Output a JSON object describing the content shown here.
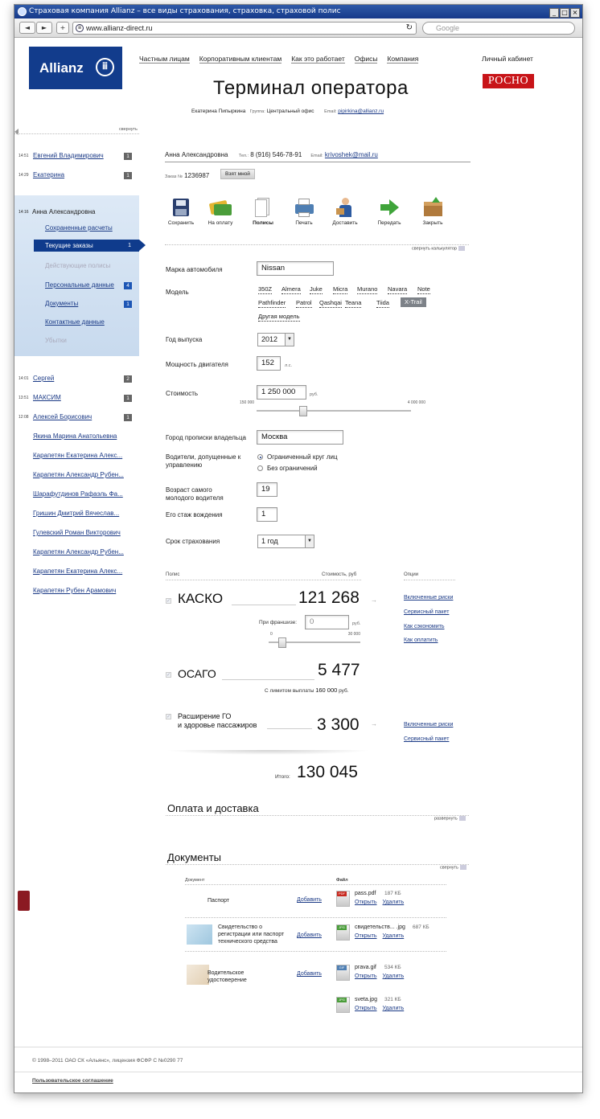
{
  "browser": {
    "title": "Страховая компания Allianz – все виды страхования, страховка, страховой полис",
    "url": "www.allianz-direct.ru",
    "search_placeholder": "Google",
    "back": "◄",
    "forward": "►",
    "add": "+"
  },
  "header": {
    "logo": "Allianz",
    "logo_symbol": "ⅲ",
    "nav": [
      "Частным лицам",
      "Корпоративным клиентам",
      "Как это работает",
      "Офисы",
      "Компания"
    ],
    "cabinet": "Личный кабинет",
    "partner_logo": "РОСНО",
    "page_title": "Терминал оператора",
    "operator_name": "Екатерина Пипыркина",
    "group_label": "Группа:",
    "group_value": "Центральный офис",
    "email_label": "Email:",
    "email_value": "pipirkina@allianz.ru"
  },
  "sidebar": {
    "collapse_label": "свернуть",
    "clients_top": [
      {
        "time": "14:51",
        "name": "Евгений Владимирович",
        "count": "1"
      },
      {
        "time": "14:29",
        "name": "Екатерина",
        "count": "1"
      }
    ],
    "active_client": {
      "time": "14:16",
      "name": "Анна Александровна",
      "items": [
        {
          "label": "Сохраненные расчеты",
          "badge": "",
          "state": "link"
        },
        {
          "label": "Текущие заказы",
          "badge": "1",
          "state": "active"
        },
        {
          "label": "Действующие полисы",
          "badge": "",
          "state": "disabled"
        },
        {
          "label": "Персональные данные",
          "badge": "4",
          "state": "link"
        },
        {
          "label": "Документы",
          "badge": "1",
          "state": "link"
        },
        {
          "label": "Контактные данные",
          "badge": "",
          "state": "link"
        },
        {
          "label": "Убытки",
          "badge": "",
          "state": "disabled"
        }
      ]
    },
    "clients_bottom": [
      {
        "time": "14:01",
        "name": "Сергей",
        "count": "2"
      },
      {
        "time": "13:51",
        "name": "МАКСИМ",
        "count": "1"
      },
      {
        "time": "12:08",
        "name": "Алексей Борисович",
        "count": "1"
      }
    ],
    "clients_list": [
      "Якина Марина Анатольевна",
      "Карапетян Екатерина Алекс...",
      "Карапетян Александр Рубен...",
      "Шарафутдинов Рафаэль Фа...",
      "Гришин Дмитрий Вячеслав...",
      "Гулевский Роман Викторович",
      "Карапетян Александр Рубен...",
      "Карапетян Екатерина Алекс...",
      "Карапетян Рубен Арамович"
    ]
  },
  "customer": {
    "name": "Анна Александровна",
    "phone_label": "Тел.:",
    "phone": "8 (916) 546-78-91",
    "email_label": "Email:",
    "email": "krivoshek@mail.ru",
    "order_label": "Заказ №",
    "order_number": "1236987",
    "take_button": "Взят мной"
  },
  "toolbar": [
    {
      "label": "Сохранить",
      "icon": "floppy-disk-icon"
    },
    {
      "label": "На оплату",
      "icon": "credit-cards-icon"
    },
    {
      "label": "Полисы",
      "icon": "documents-icon"
    },
    {
      "label": "Печать",
      "icon": "printer-icon"
    },
    {
      "label": "Доставить",
      "icon": "courier-icon"
    },
    {
      "label": "Передать",
      "icon": "green-arrow-icon"
    },
    {
      "label": "Закрыть",
      "icon": "box-icon"
    }
  ],
  "calc": {
    "collapse_label": "свернуть калькулятор",
    "car_make_label": "Марка автомобиля",
    "car_make_value": "Nissan",
    "model_label": "Модель",
    "models_row1": [
      "350Z",
      "Almera",
      "Juke",
      "Micra",
      "Murano",
      "Navara",
      "Note"
    ],
    "models_row2": [
      "Pathfinder",
      "Patrol",
      "Qashqai",
      "Teana",
      "Tiida",
      "X-Trail"
    ],
    "selected_model": "X-Trail",
    "other_model": "Другая модель",
    "year_label": "Год выпуска",
    "year_value": "2012",
    "power_label": "Мощность двигателя",
    "power_value": "152",
    "power_unit": "л.с.",
    "price_label": "Стоимость",
    "price_value": "1 250 000",
    "price_unit": "руб.",
    "price_min": "150 000",
    "price_max": "4 000 000",
    "price_slider_fraction": 0.29,
    "city_label": "Город прописки владельца",
    "city_value": "Москва",
    "drivers_label": "Водители, допущенные к управлению",
    "drivers_opt1": "Ограниченный круг лиц",
    "drivers_opt2": "Без ограничений",
    "young_age_label": "Возраст самого молодого водителя",
    "young_age_value": "19",
    "experience_label": "Его стаж вождения",
    "experience_value": "1",
    "term_label": "Срок страхования",
    "term_value": "1 год"
  },
  "policies": {
    "col_policy": "Полис",
    "col_cost": "Стоимость, руб",
    "col_options": "Опции",
    "kasko": {
      "name": "КАСКО",
      "price": "121 268",
      "deductible_label": "При франшизе:",
      "deductible_value": "0",
      "deductible_unit": "руб.",
      "ded_min": "0",
      "ded_max": "30 000",
      "ded_fraction": 0.0,
      "options": [
        "Включенные риски",
        "Сервисный пакет",
        "Как сэкономить",
        "Как оплатить"
      ]
    },
    "osago": {
      "name": "ОСАГО",
      "price": "5 477",
      "limit_label": "С лимитом выплаты",
      "limit_value": "160 000",
      "limit_unit": "руб."
    },
    "go": {
      "name_line1": "Расширение ГО",
      "name_line2": "и здоровье пассажиров",
      "price": "3 300",
      "options": [
        "Включенные риски",
        "Сервисный пакет"
      ]
    },
    "total_label": "Итого:",
    "total_value": "130 045"
  },
  "payment": {
    "title": "Оплата и доставка",
    "toggle": "развернуть"
  },
  "documents": {
    "title": "Документы",
    "toggle": "свернуть",
    "col_doc": "Документ",
    "col_file": "Файл",
    "add_label": "Добавить",
    "open_label": "Открыть",
    "delete_label": "Удалить",
    "rows": [
      {
        "name": "Паспорт",
        "files": [
          {
            "type": "PDF",
            "name": "pass.pdf",
            "size": "187 КБ"
          }
        ]
      },
      {
        "name": "Свидетельство о регистрации или паспорт технического средства",
        "files": [
          {
            "type": "JPG",
            "name": "свидетельств... .jpg",
            "size": "687 КБ"
          }
        ]
      },
      {
        "name": "Водительское удостоверение",
        "files": [
          {
            "type": "GIF",
            "name": "prava.gif",
            "size": "534 КБ"
          },
          {
            "type": "JPG",
            "name": "sveta.jpg",
            "size": "321 КБ"
          }
        ]
      }
    ]
  },
  "footer": {
    "copyright": "© 1998–2011 ОАО СК «Альянс», лицензия ФСФР С №0290 77",
    "agreement": "Пользовательское соглашение"
  }
}
